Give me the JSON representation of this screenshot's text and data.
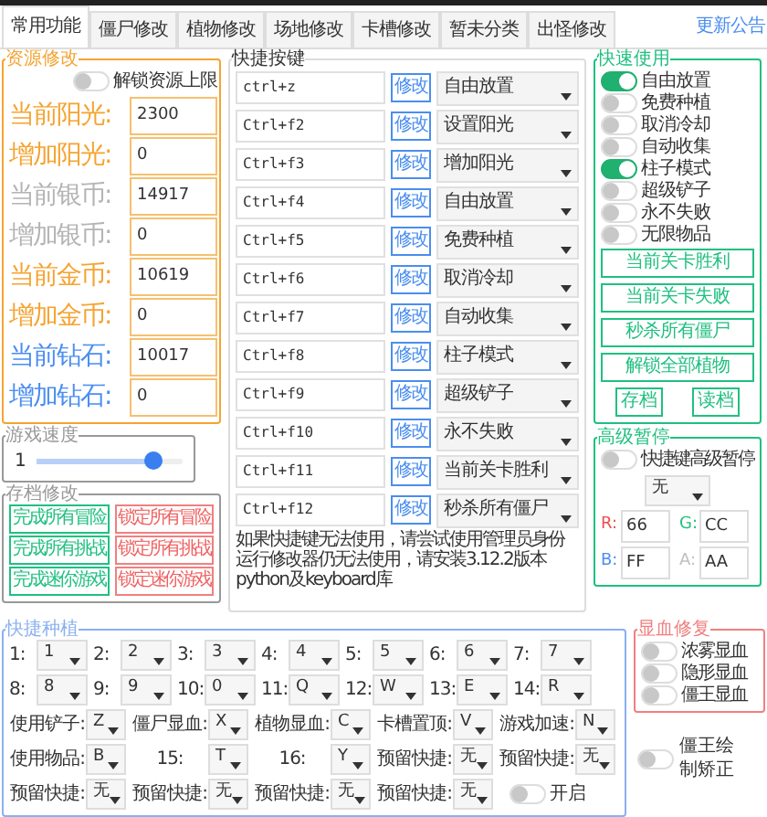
{
  "tabs": [
    {
      "label": "常用功能",
      "selected": true
    },
    {
      "label": "僵尸修改",
      "selected": false
    },
    {
      "label": "植物修改",
      "selected": false
    },
    {
      "label": "场地修改",
      "selected": false
    },
    {
      "label": "卡槽修改",
      "selected": false
    },
    {
      "label": "暂未分类",
      "selected": false
    },
    {
      "label": "出怪修改",
      "selected": false
    }
  ],
  "update_notice": "更新公告",
  "resources": {
    "title": "资源修改",
    "unlock_toggle": {
      "label": "解锁资源上限",
      "on": false
    },
    "fields": [
      {
        "label": "当前阳光:",
        "value": "2300",
        "color": "#f5a431"
      },
      {
        "label": "增加阳光:",
        "value": "0",
        "color": "#f5a431"
      },
      {
        "label": "当前银币:",
        "value": "14917",
        "color": "#b4b4b4"
      },
      {
        "label": "增加银币:",
        "value": "0",
        "color": "#b4b4b4"
      },
      {
        "label": "当前金币:",
        "value": "10619",
        "color": "#f5a431"
      },
      {
        "label": "增加金币:",
        "value": "0",
        "color": "#f5a431"
      },
      {
        "label": "当前钻石:",
        "value": "10017",
        "color": "#4a8ef0"
      },
      {
        "label": "增加钻石:",
        "value": "0",
        "color": "#4a8ef0"
      }
    ]
  },
  "speed": {
    "title": "游戏速度",
    "value": "1",
    "level": 0.8
  },
  "save_edit": {
    "title": "存档修改",
    "buttons": [
      {
        "label": "完成所有冒险",
        "kind": "complete"
      },
      {
        "label": "锁定所有冒险",
        "kind": "lock"
      },
      {
        "label": "完成所有挑战",
        "kind": "complete"
      },
      {
        "label": "锁定所有挑战",
        "kind": "lock"
      },
      {
        "label": "完成迷你游戏",
        "kind": "complete"
      },
      {
        "label": "锁定迷你游戏",
        "kind": "lock"
      }
    ]
  },
  "hotkeys": {
    "title": "快捷按键",
    "rows": [
      {
        "key": "ctrl+z",
        "button": "修改",
        "action": "自由放置"
      },
      {
        "key": "Ctrl+f2",
        "button": "修改",
        "action": "设置阳光"
      },
      {
        "key": "Ctrl+f3",
        "button": "修改",
        "action": "增加阳光"
      },
      {
        "key": "Ctrl+f4",
        "button": "修改",
        "action": "自由放置"
      },
      {
        "key": "Ctrl+f5",
        "button": "修改",
        "action": "免费种植"
      },
      {
        "key": "Ctrl+f6",
        "button": "修改",
        "action": "取消冷却"
      },
      {
        "key": "Ctrl+f7",
        "button": "修改",
        "action": "自动收集"
      },
      {
        "key": "Ctrl+f8",
        "button": "修改",
        "action": "柱子模式"
      },
      {
        "key": "Ctrl+f9",
        "button": "修改",
        "action": "超级铲子"
      },
      {
        "key": "Ctrl+f10",
        "button": "修改",
        "action": "永不失败"
      },
      {
        "key": "Ctrl+f11",
        "button": "修改",
        "action": "当前关卡胜利"
      },
      {
        "key": "Ctrl+f12",
        "button": "修改",
        "action": "秒杀所有僵尸"
      }
    ],
    "note": "如果快捷键无法使用，请尝试使用管理员身份运行修改器仍无法使用，请安装3.12.2版本python及keyboard库"
  },
  "quick_use": {
    "title": "快速使用",
    "toggles": [
      {
        "label": "自由放置",
        "on": true
      },
      {
        "label": "免费种植",
        "on": false
      },
      {
        "label": "取消冷却",
        "on": false
      },
      {
        "label": "自动收集",
        "on": false
      },
      {
        "label": "柱子模式",
        "on": true
      },
      {
        "label": "超级铲子",
        "on": false
      },
      {
        "label": "永不失败",
        "on": false
      },
      {
        "label": "无限物品",
        "on": false
      }
    ],
    "buttons": [
      "当前关卡胜利",
      "当前关卡失败",
      "秒杀所有僵尸",
      "解锁全部植物"
    ],
    "small_buttons": [
      "存档",
      "读档"
    ]
  },
  "advanced_pause": {
    "title": "高级暂停",
    "toggle": {
      "label": "快捷键高级暂停",
      "on": false
    },
    "select": "无",
    "channels": [
      {
        "label": "R:",
        "value": "66",
        "color": "#f05050"
      },
      {
        "label": "G:",
        "value": "CC",
        "color": "#20c080"
      },
      {
        "label": "B:",
        "value": "FF",
        "color": "#4a8ef0"
      },
      {
        "label": "A:",
        "value": "AA",
        "color": "#c0c0c0"
      }
    ]
  },
  "quick_plant": {
    "title": "快捷种植",
    "rows": [
      [
        {
          "label": "1:",
          "value": "1"
        },
        {
          "label": "2:",
          "value": "2"
        },
        {
          "label": "3:",
          "value": "3"
        },
        {
          "label": "4:",
          "value": "4"
        },
        {
          "label": "5:",
          "value": "5"
        },
        {
          "label": "6:",
          "value": "6"
        },
        {
          "label": "7:",
          "value": "7"
        }
      ],
      [
        {
          "label": "8:",
          "value": "8"
        },
        {
          "label": "9:",
          "value": "9"
        },
        {
          "label": "10:",
          "value": "0"
        },
        {
          "label": "11:",
          "value": "Q"
        },
        {
          "label": "12:",
          "value": "W"
        },
        {
          "label": "13:",
          "value": "E"
        },
        {
          "label": "14:",
          "value": "R"
        }
      ],
      [
        {
          "label": "使用铲子:",
          "value": "Z"
        },
        {
          "label": "僵尸显血:",
          "value": "X"
        },
        {
          "label": "植物显血:",
          "value": "C"
        },
        {
          "label": "卡槽置顶:",
          "value": "V"
        },
        {
          "label": "游戏加速:",
          "value": "N"
        }
      ],
      [
        {
          "label": "使用物品:",
          "value": "B"
        },
        {
          "label": "15:",
          "value": "T"
        },
        {
          "label": "16:",
          "value": "Y"
        },
        {
          "label": "预留快捷:",
          "value": "无"
        },
        {
          "label": "预留快捷:",
          "value": "无"
        }
      ],
      [
        {
          "label": "预留快捷:",
          "value": "无"
        },
        {
          "label": "预留快捷:",
          "value": "无"
        },
        {
          "label": "预留快捷:",
          "value": "无"
        },
        {
          "label": "预留快捷:",
          "value": "无"
        }
      ]
    ],
    "toggle": {
      "label": "开启",
      "on": false
    }
  },
  "blood_repair": {
    "title": "显血修复",
    "toggles": [
      {
        "label": "浓雾显血",
        "on": false
      },
      {
        "label": "隐形显血",
        "on": false
      },
      {
        "label": "僵王显血",
        "on": false
      }
    ]
  },
  "boss_toggle": {
    "label": "僵王绘制矫正",
    "on": false
  }
}
